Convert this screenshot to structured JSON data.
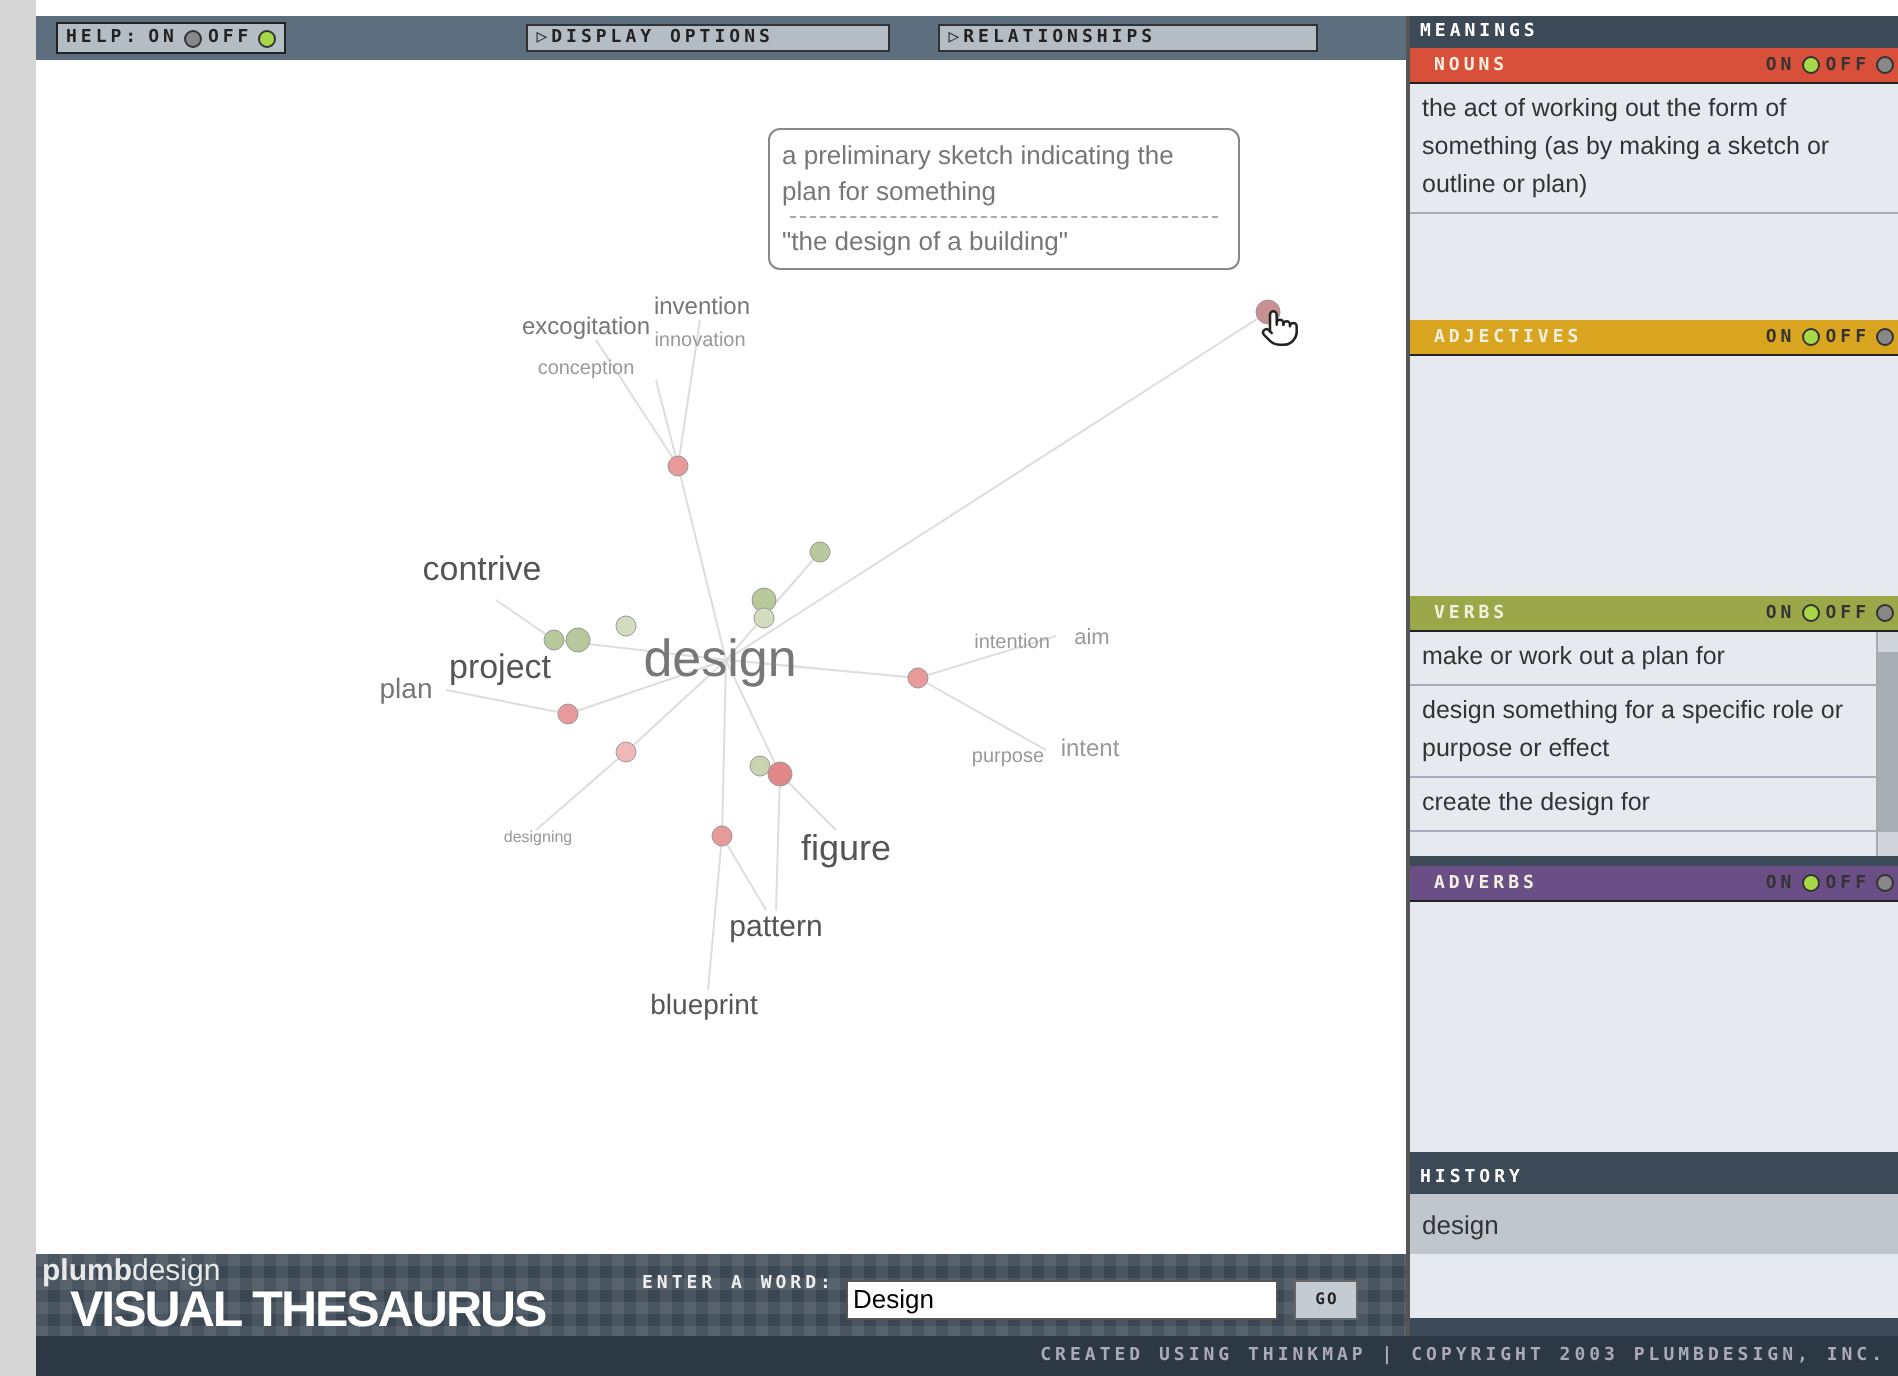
{
  "toolbar": {
    "help": {
      "label": "HELP:",
      "options": [
        {
          "label": "ON",
          "selected": false
        },
        {
          "label": "OFF",
          "selected": true
        }
      ]
    },
    "menus": [
      {
        "label": "DISPLAY OPTIONS",
        "glyph": "▷"
      },
      {
        "label": "RELATIONSHIPS",
        "glyph": "▷"
      }
    ]
  },
  "graph": {
    "tooltip": {
      "definition": "a preliminary sketch indicating the plan for something",
      "example": "\"the design of a building\""
    },
    "words": [
      {
        "text": "design"
      },
      {
        "text": "contrive"
      },
      {
        "text": "project"
      },
      {
        "text": "plan"
      },
      {
        "text": "excogitation"
      },
      {
        "text": "invention"
      },
      {
        "text": "innovation"
      },
      {
        "text": "conception"
      },
      {
        "text": "intention"
      },
      {
        "text": "aim"
      },
      {
        "text": "intent"
      },
      {
        "text": "purpose"
      },
      {
        "text": "designing"
      },
      {
        "text": "figure"
      },
      {
        "text": "pattern"
      },
      {
        "text": "blueprint"
      }
    ],
    "nodes": [
      {
        "color": "#e89a9a"
      },
      {
        "color": "#b8c89a"
      },
      {
        "color": "#b8c89a"
      },
      {
        "color": "#d4dcc0"
      },
      {
        "color": "#d4dcc0"
      },
      {
        "color": "#b8c89a"
      },
      {
        "color": "#b8c89a"
      },
      {
        "color": "#e89a9a"
      },
      {
        "color": "#f0b8b8"
      },
      {
        "color": "#e89a9a"
      },
      {
        "color": "#c8d4b0"
      },
      {
        "color": "#e08888"
      },
      {
        "color": "#e89a9a"
      },
      {
        "color": "#c89090"
      }
    ]
  },
  "search": {
    "logo_top": "**plumb**design",
    "logo_bottom": "VISUAL THESAURUS",
    "label": "ENTER A WORD:",
    "value": "Design",
    "button": "GO"
  },
  "footer": "CREATED USING THINKMAP | COPYRIGHT 2003 PLUMBDESIGN, INC.",
  "meanings": {
    "title": "MEANINGS",
    "sections": [
      {
        "label": "NOUNS",
        "color": "#d9503a",
        "options": [
          {
            "label": "ON",
            "selected": true
          },
          {
            "label": "OFF",
            "selected": false
          }
        ],
        "entries": [
          "the act of working out the form of something (as by making a sketch or outline or plan)"
        ]
      },
      {
        "label": "ADJECTIVES",
        "color": "#d9a520",
        "options": [
          {
            "label": "ON",
            "selected": true
          },
          {
            "label": "OFF",
            "selected": false
          }
        ]
      },
      {
        "label": "VERBS",
        "color": "#9aa84a",
        "options": [
          {
            "label": "ON",
            "selected": true
          },
          {
            "label": "OFF",
            "selected": false
          }
        ],
        "entries": [
          "make or work out a plan for",
          "design something for a specific role or purpose or effect",
          "create the design for"
        ]
      },
      {
        "label": "ADVERBS",
        "color": "#6a4f86",
        "options": [
          {
            "label": "ON",
            "selected": true
          },
          {
            "label": "OFF",
            "selected": false
          }
        ]
      }
    ]
  },
  "history": {
    "title": "HISTORY",
    "items": [
      "design"
    ]
  }
}
